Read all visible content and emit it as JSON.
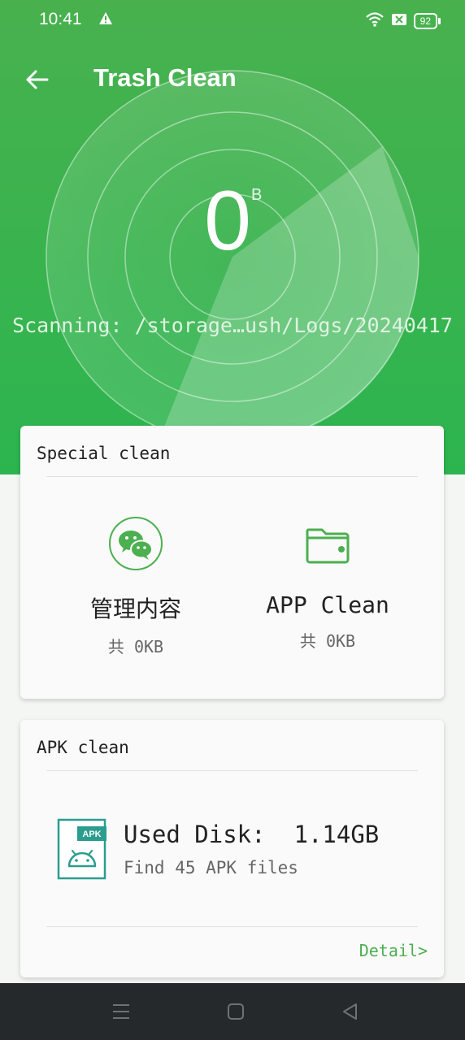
{
  "status_bar": {
    "time": "10:41",
    "icons": [
      "alert-icon",
      "wifi-icon",
      "sim-off-icon",
      "battery-icon"
    ],
    "battery_level": "92"
  },
  "header": {
    "title": "Trash Clean",
    "back_icon": "arrow-left-icon"
  },
  "scan": {
    "size_value": "0",
    "size_unit": "B",
    "status_text": "Scanning: /storage…ush/Logs/20240417"
  },
  "special_clean": {
    "title": "Special clean",
    "items": [
      {
        "icon": "wechat-icon",
        "name": "管理内容",
        "size": "共 0KB"
      },
      {
        "icon": "folder-wallet-icon",
        "name": "APP Clean",
        "size": "共 0KB"
      }
    ]
  },
  "apk_clean": {
    "title": "APK clean",
    "icon": "apk-file-icon",
    "icon_badge": "APK",
    "used_disk": "Used Disk:  1.14GB",
    "files_found": "Find 45 APK files",
    "detail_link": "Detail>"
  },
  "nav_bar": {
    "icons": [
      "menu-icon",
      "home-icon",
      "back-triangle-icon"
    ]
  },
  "colors": {
    "brand_green": "#3db34f",
    "accent_green": "#4caf50",
    "nav_bar": "#26292c"
  }
}
